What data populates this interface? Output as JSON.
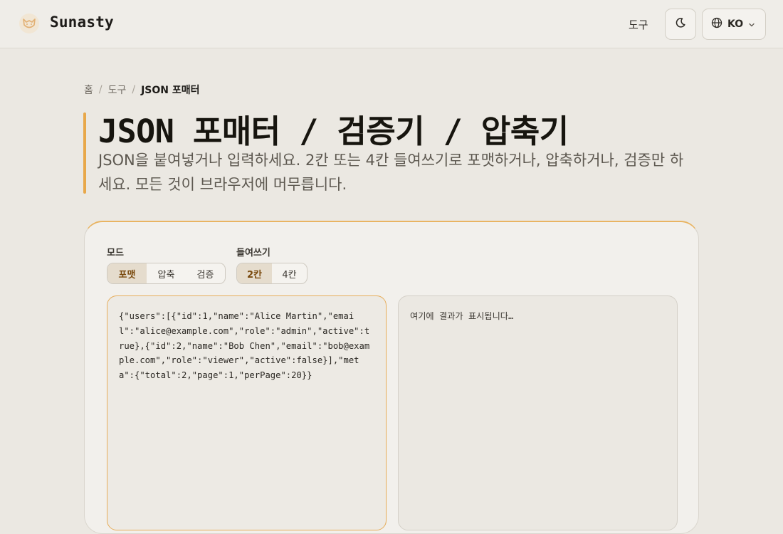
{
  "header": {
    "brand": "Sunasty",
    "nav_tools": "도구",
    "language": "KO"
  },
  "breadcrumb": {
    "home": "홈",
    "tools": "도구",
    "current": "JSON 포매터"
  },
  "hero": {
    "title": "JSON 포매터 / 검증기 / 압축기",
    "description": "JSON을 붙여넣거나 입력하세요. 2칸 또는 4칸 들여쓰기로 포맷하거나, 압축하거나, 검증만 하세요. 모든 것이 브라우저에 머무릅니다."
  },
  "tool": {
    "mode_label": "모드",
    "modes": [
      "포맷",
      "압축",
      "검증"
    ],
    "active_mode": "포맷",
    "indent_label": "들여쓰기",
    "indents": [
      "2칸",
      "4칸"
    ],
    "active_indent": "2칸",
    "input_value": "{\"users\":[{\"id\":1,\"name\":\"Alice Martin\",\"email\":\"alice@example.com\",\"role\":\"admin\",\"active\":true},{\"id\":2,\"name\":\"Bob Chen\",\"email\":\"bob@example.com\",\"role\":\"viewer\",\"active\":false}],\"meta\":{\"total\":2,\"page\":1,\"perPage\":20}}",
    "output_placeholder": "여기에 결과가 표시됩니다…"
  },
  "colors": {
    "accent": "#e8a84a",
    "active_segment_bg": "#e5dccd",
    "active_segment_text": "#7a4a0e",
    "background": "#ebe8e2"
  },
  "icons": {
    "logo": "fox-logo-icon",
    "theme": "moon-icon",
    "language": "globe-icon",
    "dropdown": "chevron-down-icon"
  }
}
